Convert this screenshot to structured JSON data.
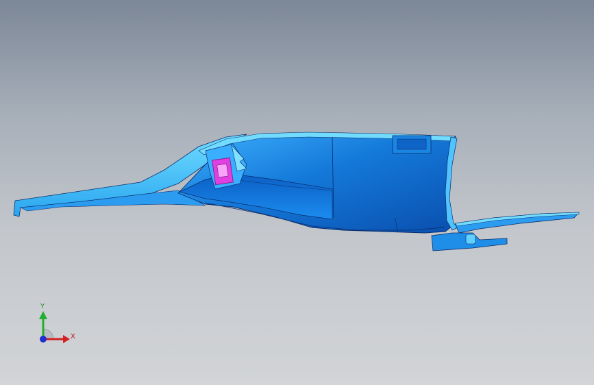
{
  "viewport": {
    "background_top": "#7c8797",
    "background_bottom": "#d2d4d7"
  },
  "model": {
    "part_color": "#1a8ee8",
    "edge_color": "#0a2c6a",
    "highlight_color": "#5fd0ff",
    "clip_color": "#e040e0"
  },
  "triad": {
    "x_label": "X",
    "y_label": "Y",
    "x_color": "#d42020",
    "y_color": "#20b030",
    "z_color": "#2030d0"
  }
}
